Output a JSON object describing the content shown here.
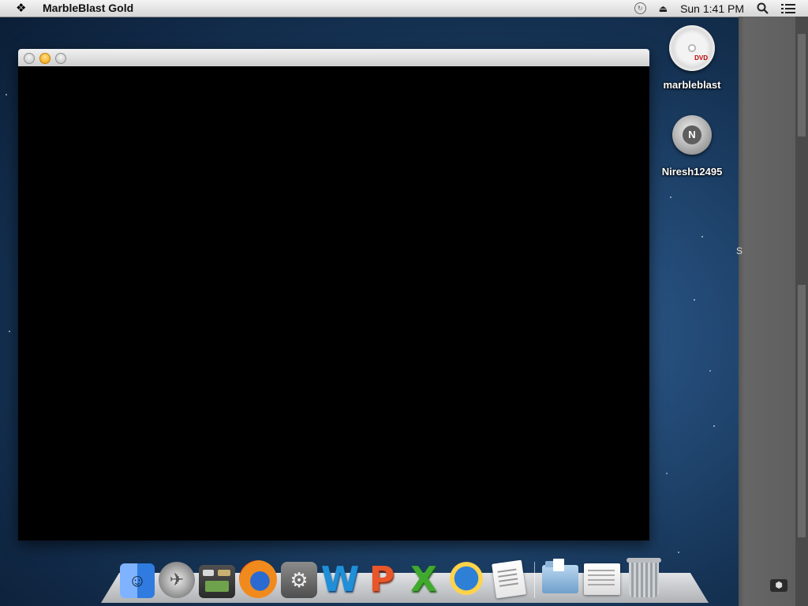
{
  "menubar": {
    "app_title": "MarbleBlast Gold",
    "clock": "Sun 1:41 PM",
    "icons": [
      "apple-cursor-icon",
      "time-machine-icon",
      "eject-icon",
      "spotlight-icon",
      "notification-icon"
    ]
  },
  "window": {
    "controls": [
      "close",
      "minimize",
      "zoom"
    ],
    "content_color": "#000000"
  },
  "desktop": {
    "icons": [
      {
        "label": "marbleblast",
        "icon": "dvd-disc-icon"
      },
      {
        "label": "Niresh12495",
        "icon": "hard-drive-icon"
      }
    ]
  },
  "right_panel": {
    "glyph": "S"
  },
  "dock": {
    "apps": [
      {
        "name": "Finder",
        "icon": "finder-icon"
      },
      {
        "name": "Launchpad",
        "icon": "launchpad-icon"
      },
      {
        "name": "Mission Control",
        "icon": "mission-control-icon"
      },
      {
        "name": "Firefox",
        "icon": "firefox-icon"
      },
      {
        "name": "System Preferences",
        "icon": "system-preferences-icon"
      },
      {
        "name": "Microsoft Word",
        "icon": "word-icon",
        "glyph": "W"
      },
      {
        "name": "Microsoft PowerPoint",
        "icon": "powerpoint-icon",
        "glyph": "P"
      },
      {
        "name": "Microsoft Excel",
        "icon": "excel-icon",
        "glyph": "X"
      },
      {
        "name": "Sun Globe App",
        "icon": "sun-globe-icon"
      },
      {
        "name": "TextEdit",
        "icon": "textedit-icon"
      }
    ],
    "others": [
      {
        "name": "Downloads",
        "icon": "downloads-folder-icon"
      },
      {
        "name": "Documents",
        "icon": "documents-stack-icon"
      },
      {
        "name": "Trash",
        "icon": "trash-icon"
      }
    ]
  },
  "colors": {
    "accent_minimize": "#f0a000",
    "desktop_blue": "#244c78"
  }
}
